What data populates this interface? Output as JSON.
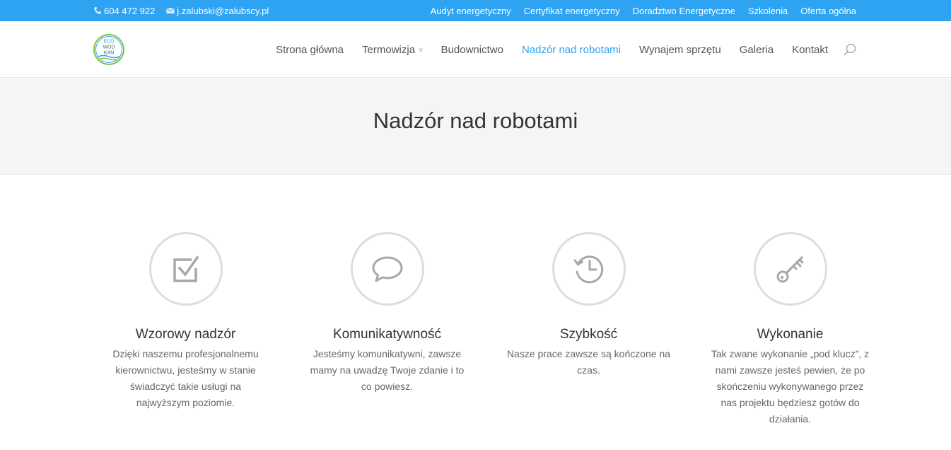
{
  "topbar": {
    "phone": "604 472 922",
    "email": "j.zalubski@zalubscy.pl",
    "links": [
      "Audyt energetyczny",
      "Certyfikat energetyczny",
      "Doradztwo Energetyczne",
      "Szkolenia",
      "Oferta ogólna"
    ]
  },
  "logo": {
    "lines": [
      "ECO",
      "WOD",
      "KAN"
    ]
  },
  "nav": {
    "items": [
      "Strona główna",
      "Termowizja",
      "Budownictwo",
      "Nadzór nad robotami",
      "Wynajem sprzętu",
      "Galeria",
      "Kontakt"
    ],
    "active_index": 3,
    "dropdown_caret": "v"
  },
  "page": {
    "title": "Nadzór nad robotami"
  },
  "features": [
    {
      "icon": "checkbox-icon",
      "title": "Wzorowy nadzór",
      "text": "Dzięki naszemu profesjonalnemu kierownictwu, jesteśmy w stanie świadczyć takie usługi na najwyższym poziomie."
    },
    {
      "icon": "speech-bubble-icon",
      "title": "Komunikatywność",
      "text": "Jesteśmy komunikatywni, zawsze mamy na uwadzę Twoje zdanie i to co powiesz."
    },
    {
      "icon": "history-clock-icon",
      "title": "Szybkość",
      "text": "Nasze prace zawsze są kończone na czas."
    },
    {
      "icon": "key-icon",
      "title": "Wykonanie",
      "text": "Tak zwane wykonanie „pod klucz”, z nami zawsze jesteś pewien, że po skończeniu wykonywanego przez nas projektu będziesz gotów do działania."
    }
  ],
  "colors": {
    "accent": "#2ea3f2",
    "title_band": "#f5f5f5",
    "icon": "#a8a8a8",
    "circle_border": "#dddddd"
  }
}
